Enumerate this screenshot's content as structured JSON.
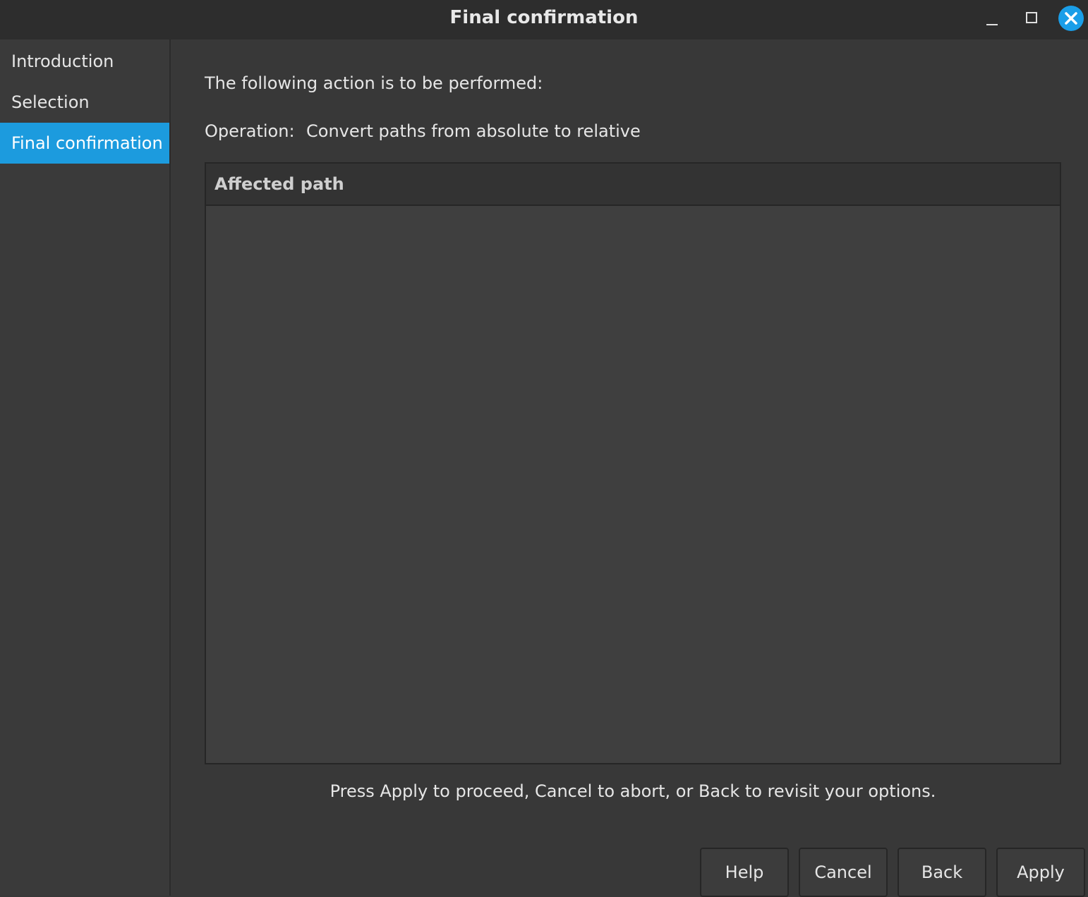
{
  "window": {
    "title": "Final confirmation"
  },
  "sidebar": {
    "items": [
      {
        "label": "Introduction",
        "active": false
      },
      {
        "label": "Selection",
        "active": false
      },
      {
        "label": "Final confirmation",
        "active": true
      }
    ]
  },
  "main": {
    "intro": "The following action is to be performed:",
    "operation_label": "Operation:",
    "operation_value": "Convert paths from absolute to relative",
    "table": {
      "columns": [
        "Affected path"
      ],
      "rows": []
    },
    "hint": "Press Apply to proceed, Cancel to abort, or Back to revisit your options."
  },
  "buttons": {
    "help": "Help",
    "cancel": "Cancel",
    "back": "Back",
    "apply": "Apply"
  },
  "colors": {
    "accent": "#1c9bde",
    "background": "#383838",
    "titlebar": "#2d2d2d",
    "close_button": "#1a9ee8"
  }
}
